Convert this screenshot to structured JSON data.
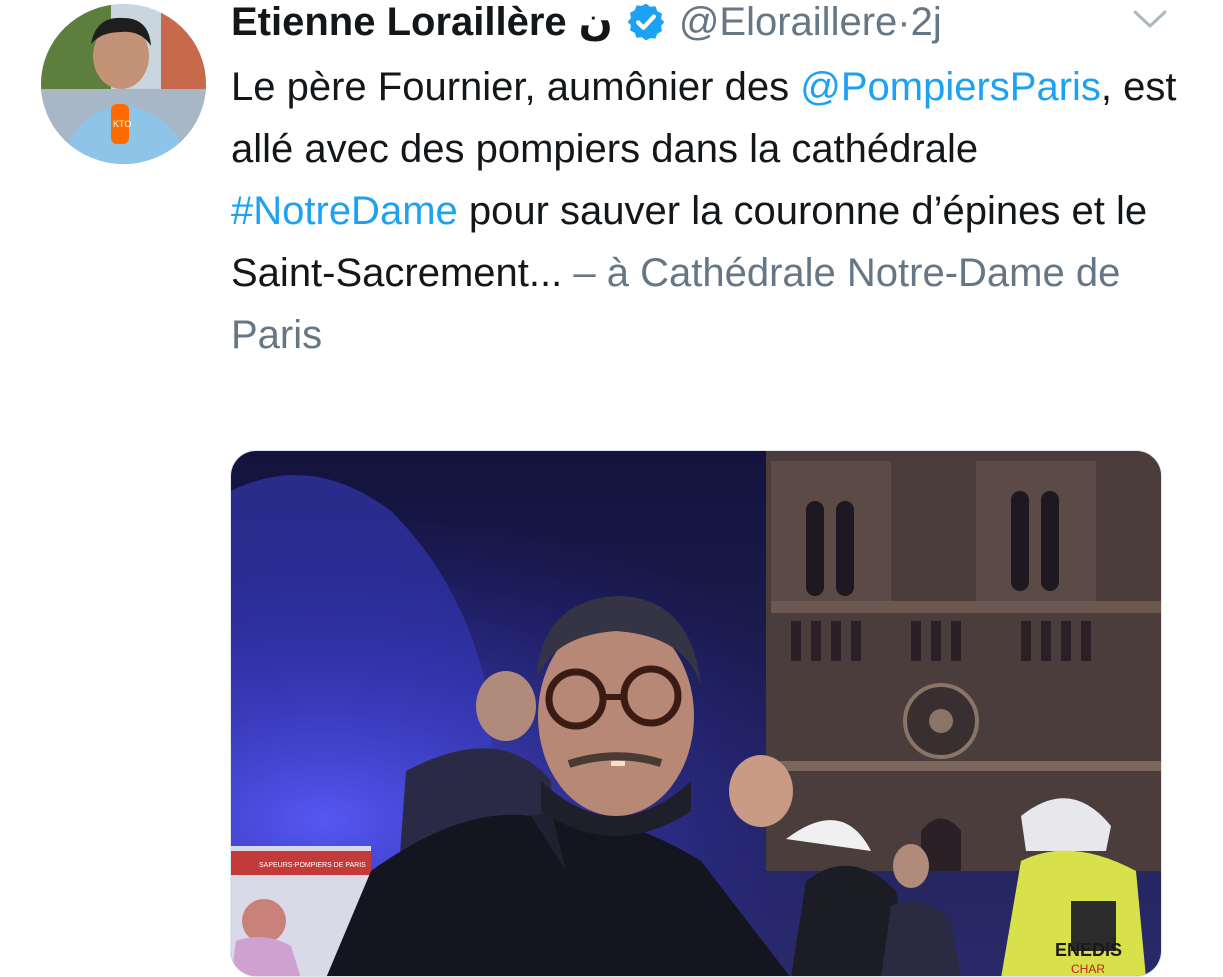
{
  "tweet": {
    "author_name": "Etienne Loraillère",
    "author_suffix": "ن",
    "verified_icon": "verified-badge-icon",
    "handle": "@Eloraillere",
    "separator": " · ",
    "time": "2j",
    "text_line_1": "Le père Fournier, aumônier des ",
    "mention": "@PompiersParis",
    "text_line_2": ", est allé avec des pompiers dans la cathédrale ",
    "hashtag": "#NotreDame",
    "text_line_3": " pour sauver la couronne d’épines et le Saint-Sacrement...",
    "location": " – à Cathédrale Notre-Dame de Paris",
    "menu_icon": "chevron-down-icon",
    "avatar_mic_text": "KTO"
  },
  "media": {
    "description_icon": "photo",
    "truck_sign": "SAPEURS-POMPIERS DE PARIS",
    "vest_logo": "ENEDIS",
    "vest_logo_sub": "CHAR"
  },
  "colors": {
    "link": "#1da1f2",
    "secondary": "#657786",
    "text": "#14171a"
  }
}
